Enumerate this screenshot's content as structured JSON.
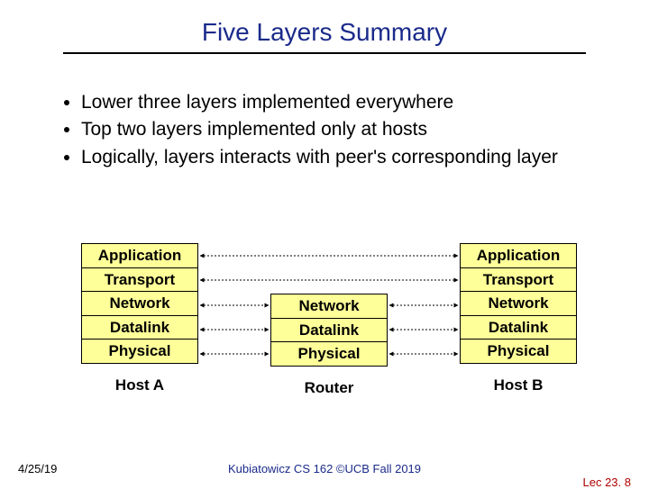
{
  "title": "Five Layers Summary",
  "bullets": [
    "Lower three layers implemented everywhere",
    "Top two layers implemented only at hosts",
    "Logically, layers interacts with peer's corresponding layer"
  ],
  "layers": {
    "application": "Application",
    "transport": "Transport",
    "network": "Network",
    "datalink": "Datalink",
    "physical": "Physical"
  },
  "nodes": {
    "hostA": "Host A",
    "router": "Router",
    "hostB": "Host B"
  },
  "footer": {
    "date": "4/25/19",
    "mid": "Kubiatowicz CS 162 ©UCB Fall 2019",
    "lec": "Lec 23. 8"
  }
}
